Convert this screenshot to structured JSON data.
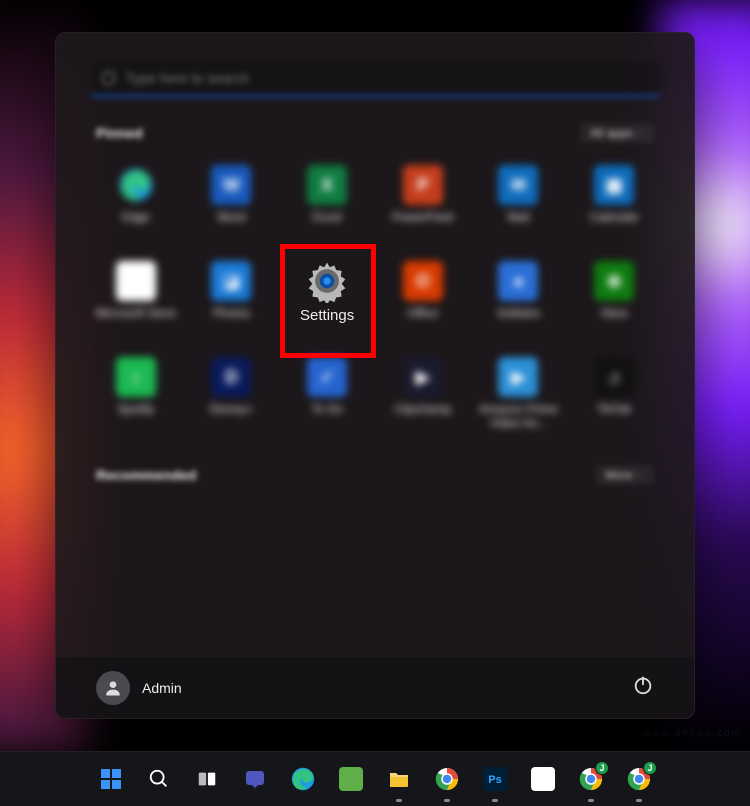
{
  "search": {
    "placeholder": "Type here to search"
  },
  "pinned": {
    "title": "Pinned",
    "all_apps_label": "All apps",
    "tiles": [
      {
        "name": "edge",
        "label": "Edge",
        "bg": "transparent",
        "glyph": "edge"
      },
      {
        "name": "word",
        "label": "Word",
        "bg": "#185abd",
        "glyph": "W"
      },
      {
        "name": "excel",
        "label": "Excel",
        "bg": "#107c41",
        "glyph": "X"
      },
      {
        "name": "powerpoint",
        "label": "PowerPoint",
        "bg": "#c43e1c",
        "glyph": "P"
      },
      {
        "name": "mail",
        "label": "Mail",
        "bg": "#0f6cbd",
        "glyph": "✉"
      },
      {
        "name": "calendar",
        "label": "Calendar",
        "bg": "#0f6cbd",
        "glyph": "▦"
      },
      {
        "name": "store",
        "label": "Microsoft Store",
        "bg": "#ffffff",
        "glyph": "🛍"
      },
      {
        "name": "photos",
        "label": "Photos",
        "bg": "#1b7ad6",
        "glyph": "◪"
      },
      {
        "name": "settings",
        "label": "Settings",
        "bg": "transparent",
        "glyph": "gear",
        "highlighted": true
      },
      {
        "name": "office",
        "label": "Office",
        "bg": "#d83b01",
        "glyph": "O"
      },
      {
        "name": "solitaire",
        "label": "Solitaire",
        "bg": "#2a6fd6",
        "glyph": "♠"
      },
      {
        "name": "xbox",
        "label": "Xbox",
        "bg": "#107c10",
        "glyph": "⊗"
      },
      {
        "name": "spotify",
        "label": "Spotify",
        "bg": "#1db954",
        "glyph": "♪"
      },
      {
        "name": "disney",
        "label": "Disney+",
        "bg": "#0a1a5c",
        "glyph": "D"
      },
      {
        "name": "todo",
        "label": "To Do",
        "bg": "#2564cf",
        "glyph": "✓"
      },
      {
        "name": "clipchamp",
        "label": "Clipchamp",
        "bg": "#1a1a2e",
        "glyph": "▶"
      },
      {
        "name": "prime",
        "label": "Amazon Prime Video for...",
        "bg": "#2b8fd6",
        "glyph": "▶"
      },
      {
        "name": "tiktok",
        "label": "TikTok",
        "bg": "#111111",
        "glyph": "♫"
      }
    ]
  },
  "recommended": {
    "title": "Recommended",
    "more_label": "More"
  },
  "user": {
    "name": "Admin"
  },
  "taskbar": [
    {
      "name": "start",
      "glyph": "win",
      "color": "#0b62d6"
    },
    {
      "name": "search",
      "glyph": "search",
      "color": "#ffffff"
    },
    {
      "name": "taskview",
      "glyph": "taskview",
      "color": "#ffffff"
    },
    {
      "name": "chat",
      "glyph": "chat",
      "color": "#4e56c0"
    },
    {
      "name": "edge",
      "glyph": "edge",
      "color": "#33c481"
    },
    {
      "name": "app1",
      "glyph": "app",
      "color": "#5eaf4a"
    },
    {
      "name": "explorer",
      "glyph": "folder",
      "color": "#f5c232"
    },
    {
      "name": "chrome",
      "glyph": "chrome",
      "color": "#e24a3b"
    },
    {
      "name": "photoshop",
      "glyph": "ps",
      "color": "#001e36"
    },
    {
      "name": "app2",
      "glyph": "app",
      "color": "#ffffff"
    },
    {
      "name": "chrome-p1",
      "glyph": "chrome",
      "color": "#e24a3b",
      "badge": "J",
      "badge_color": "#1a9e4b"
    },
    {
      "name": "chrome-p2",
      "glyph": "chrome",
      "color": "#e24a3b",
      "badge": "J",
      "badge_color": "#1a9e4b"
    }
  ],
  "colors": {
    "highlight": "#ff0000",
    "search_underline": "#0e5fd8"
  }
}
